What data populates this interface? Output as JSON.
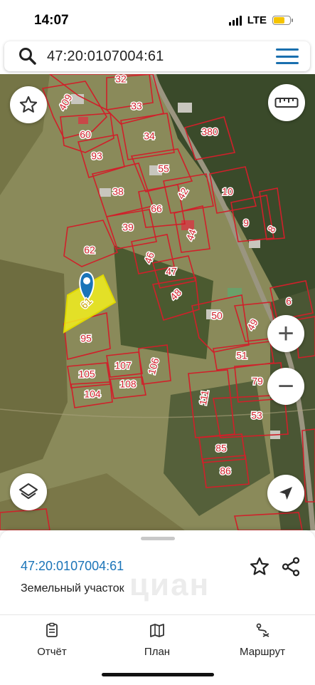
{
  "status": {
    "time": "14:07",
    "network": "LTE"
  },
  "search": {
    "value": "47:20:0107004:61"
  },
  "map": {
    "parcel_labels": [
      "409",
      "32",
      "33",
      "60",
      "93",
      "34",
      "380",
      "55",
      "10",
      "38",
      "42",
      "66",
      "9",
      "8",
      "39",
      "44",
      "62",
      "46",
      "47",
      "48",
      "61",
      "6",
      "50",
      "49",
      "95",
      "51",
      "107",
      "105",
      "106",
      "104",
      "108",
      "111",
      "79",
      "53",
      "85",
      "86"
    ],
    "selected_parcel": "61",
    "zoom_in": "+",
    "zoom_out": "−"
  },
  "sheet": {
    "cadastral_number": "47:20:0107004:61",
    "type": "Земельный участок",
    "watermark": "циан"
  },
  "tabs": [
    {
      "label": "Отчёт",
      "icon": "report-icon"
    },
    {
      "label": "План",
      "icon": "map-icon"
    },
    {
      "label": "Маршрут",
      "icon": "route-icon"
    }
  ],
  "colors": {
    "accent": "#1a6fae",
    "parcel_border": "#d0202a",
    "selected_fill": "#f2ee1e"
  }
}
